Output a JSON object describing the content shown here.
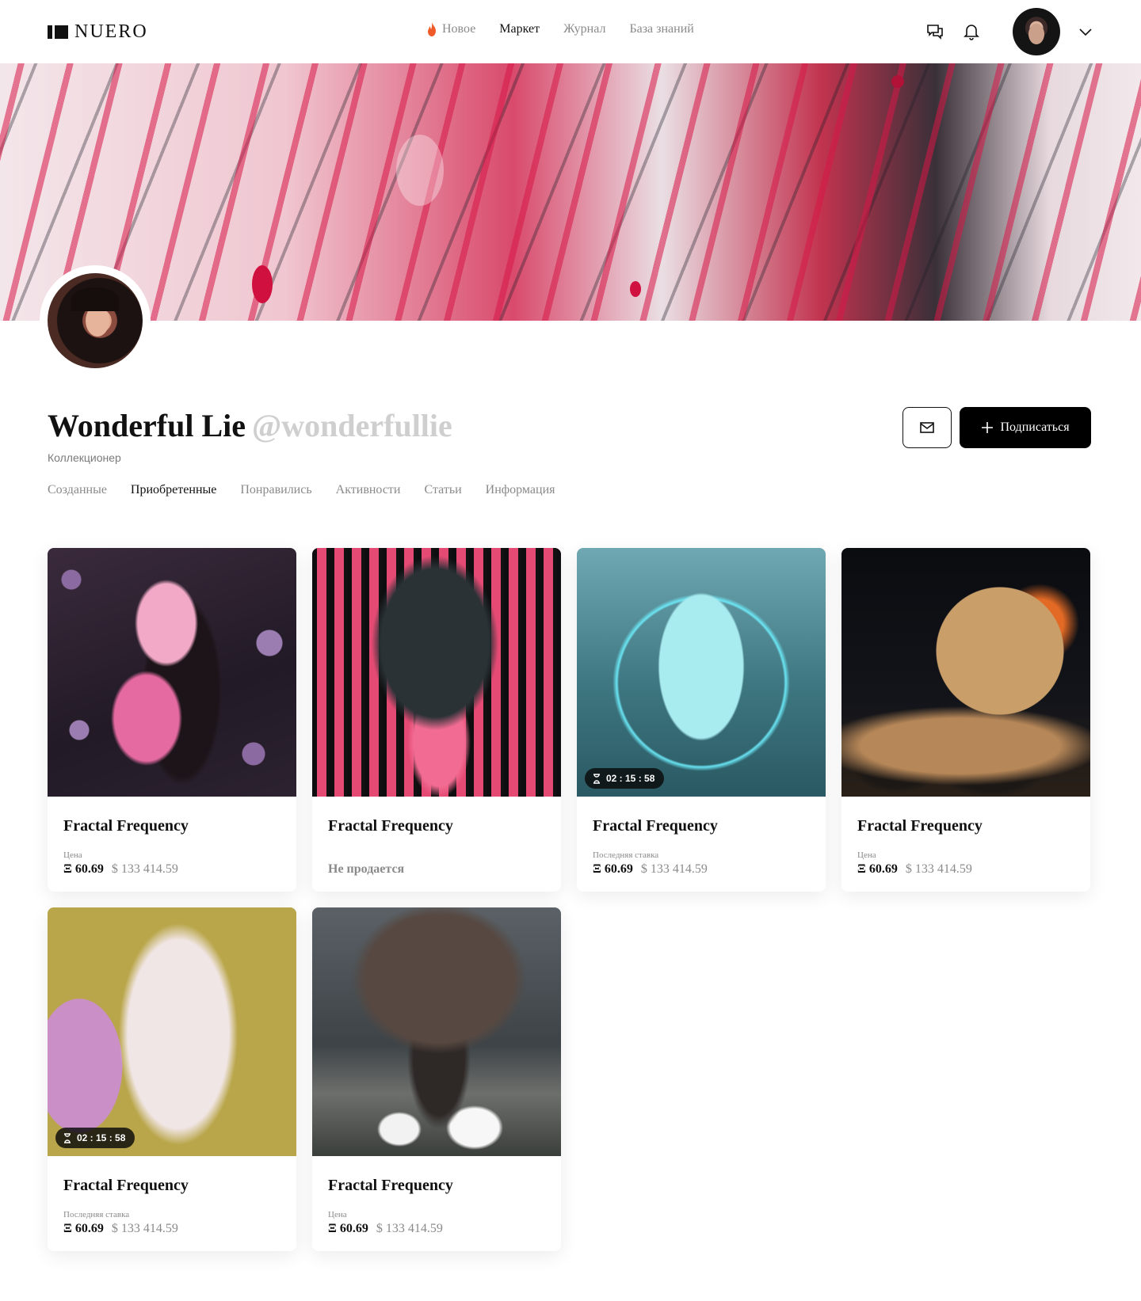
{
  "brand": {
    "name": "NUERO"
  },
  "nav": {
    "items": [
      {
        "label": "Новое",
        "icon": "flame-icon"
      },
      {
        "label": "Маркет",
        "active": true
      },
      {
        "label": "Журнал"
      },
      {
        "label": "База знаний"
      }
    ]
  },
  "profile": {
    "name": "Wonderful Lie",
    "handle": "@wonderfullie",
    "role": "Коллекционер",
    "subscribe_label": "Подписаться"
  },
  "tabs": [
    {
      "label": "Созданные"
    },
    {
      "label": "Приобретенные",
      "active": true
    },
    {
      "label": "Понравились"
    },
    {
      "label": "Активности"
    },
    {
      "label": "Статьи"
    },
    {
      "label": "Информация"
    }
  ],
  "cards": [
    {
      "title": "Fractal Frequency",
      "price_label": "Цена",
      "eth": "Ξ 60.69",
      "usd": "$ 133 414.59",
      "timer": ""
    },
    {
      "title": "Fractal Frequency",
      "not_for_sale": "Не продается",
      "timer": ""
    },
    {
      "title": "Fractal Frequency",
      "price_label": "Последняя ставка",
      "eth": "Ξ 60.69",
      "usd": "$ 133 414.59",
      "timer": "02 : 15 : 58"
    },
    {
      "title": "Fractal Frequency",
      "price_label": "Цена",
      "eth": "Ξ 60.69",
      "usd": "$ 133 414.59",
      "timer": ""
    },
    {
      "title": "Fractal Frequency",
      "price_label": "Последняя ставка",
      "eth": "Ξ 60.69",
      "usd": "$ 133 414.59",
      "timer": "02 : 15 : 58"
    },
    {
      "title": "Fractal Frequency",
      "price_label": "Цена",
      "eth": "Ξ 60.69",
      "usd": "$ 133 414.59",
      "timer": ""
    }
  ],
  "colors": {
    "accent": "#000000",
    "muted": "#8a8a8a",
    "flame": "#f05a28"
  }
}
